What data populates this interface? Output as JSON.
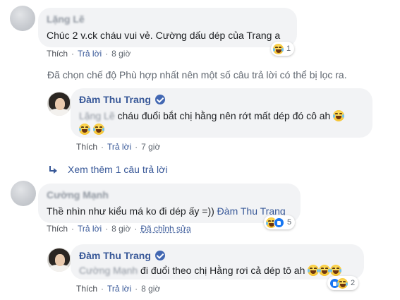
{
  "comments": [
    {
      "author": "Lặng Lẽ",
      "text": "Chúc 2 v.ck cháu vui vẻ. Cường dấu dép của Trang a",
      "reaction_count": "1",
      "actions": {
        "like": "Thích",
        "reply": "Trả lời",
        "time": "8 giờ"
      }
    },
    {
      "author": "Đàm Thu Trang",
      "mention": "Lặng Lẽ",
      "text": " cháu đuổi bắt chị hằng nên rớt mất dép đó cô ah",
      "actions": {
        "like": "Thích",
        "reply": "Trả lời",
        "time": "7 giờ"
      }
    },
    {
      "author": "Cường Mạnh",
      "text": "Thề nhìn như kiểu má ko đi dép ấy =)) ",
      "mention": "Đàm Thu Trang",
      "reaction_count": "5",
      "actions": {
        "like": "Thích",
        "reply": "Trả lời",
        "time": "8 giờ",
        "edited": "Đã chỉnh sửa"
      }
    },
    {
      "author": "Đàm Thu Trang",
      "mention": "Cường Mạnh",
      "text": " đi đuổi theo chị Hằng rơi cả dép tô ah",
      "reaction_count": "2",
      "actions": {
        "like": "Thích",
        "reply": "Trả lời",
        "time": "8 giờ"
      }
    }
  ],
  "filter_note": "Đã chọn chế độ Phù hợp nhất nên một số câu trả lời có thể bị lọc ra.",
  "more_replies": "Xem thêm 1 câu trả lời",
  "colors": {
    "link": "#385898",
    "bubble": "#f2f3f5",
    "meta": "#606770",
    "verified": "#4267b2"
  }
}
